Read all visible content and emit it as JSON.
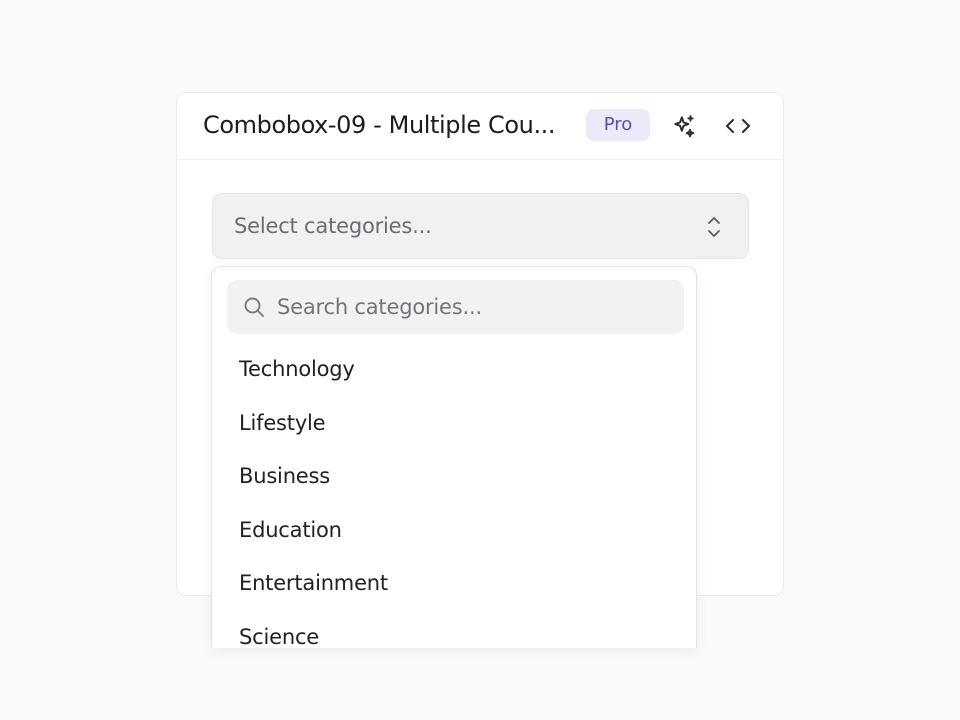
{
  "header": {
    "title": "Combobox-09 - Multiple Cou...",
    "badge": "Pro",
    "icons": [
      "sparkles-icon",
      "code-icon"
    ]
  },
  "select": {
    "placeholder": "Select categories...",
    "icon": "chevrons-up-down-icon"
  },
  "dropdown": {
    "search_placeholder": "Search categories...",
    "search_icon": "search-icon",
    "options": [
      "Technology",
      "Lifestyle",
      "Business",
      "Education",
      "Entertainment",
      "Science"
    ]
  },
  "colors": {
    "badge_bg": "#ece9fb",
    "badge_text": "#5a50a8"
  }
}
